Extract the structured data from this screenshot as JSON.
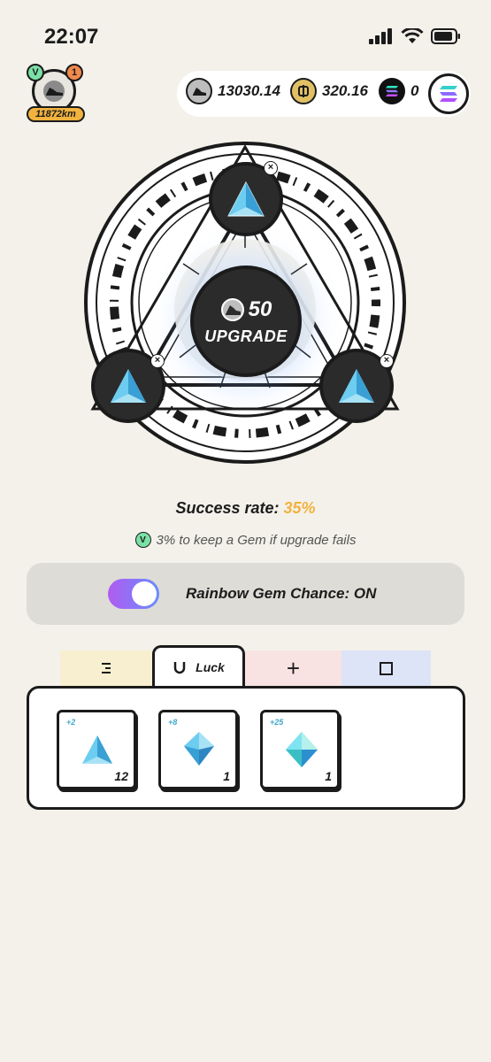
{
  "status": {
    "time": "22:07"
  },
  "user": {
    "verified_badge": "V",
    "notif_count": "1",
    "distance": "11872km",
    "avatar_icon": "sneaker-icon"
  },
  "balances": {
    "gst": "13030.14",
    "gmt": "320.16",
    "sol": "0"
  },
  "upgrade": {
    "cost": "50",
    "button_label": "UPGRADE",
    "success_label": "Success rate:",
    "success_value": "35%",
    "keep_badge": "V",
    "keep_text": "3% to keep a Gem if upgrade fails"
  },
  "rainbow": {
    "label": "Rainbow Gem Chance: ON",
    "enabled": true
  },
  "tabs": {
    "luck_label": "Luck",
    "plus_label": "+"
  },
  "inventory": [
    {
      "level": "+2",
      "count": "12",
      "gem": "luck-gem-lv1"
    },
    {
      "level": "+8",
      "count": "1",
      "gem": "luck-gem-lv2"
    },
    {
      "level": "+25",
      "count": "1",
      "gem": "luck-gem-lv3"
    }
  ],
  "colors": {
    "accent_yellow": "#f2b23e",
    "gem_blue": "#4fb6e3",
    "verified_green": "#7be0a6"
  }
}
